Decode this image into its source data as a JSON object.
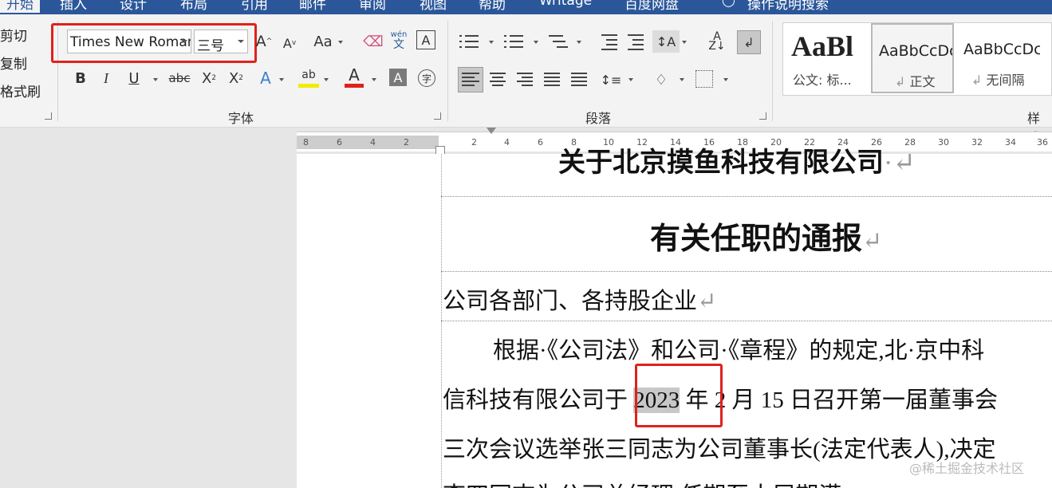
{
  "tabs": {
    "t0": "开始",
    "t1": "插入",
    "t2": "设计",
    "t3": "布局",
    "t4": "引用",
    "t5": "邮件",
    "t6": "审阅",
    "t7": "视图",
    "t8": "帮助",
    "t9": "Writage",
    "t10": "百度网盘",
    "t11": "操作说明搜索"
  },
  "clipboard": {
    "cut": "剪切",
    "copy": "复制",
    "format_painter": "格式刷"
  },
  "font": {
    "name": "Times New Roman",
    "size": "三号",
    "group_label": "字体"
  },
  "paragraph": {
    "group_label": "段落"
  },
  "styles": {
    "group_label": "样式",
    "items": [
      "公文: 标...",
      "正文",
      "无间隔"
    ],
    "previews": [
      "AaBl",
      "AaBbCcDc",
      "AaBbCcDc"
    ]
  },
  "ruler": {
    "left_numbers": [
      "8",
      "6",
      "4",
      "2"
    ],
    "right_numbers": [
      "2",
      "4",
      "6",
      "8",
      "10",
      "12",
      "14",
      "16",
      "18",
      "20",
      "22",
      "24",
      "26",
      "28",
      "30",
      "32",
      "34",
      "36"
    ]
  },
  "document": {
    "title_line1": "关于北京摸鱼科技有限公司",
    "title_line2": "有关任职的通报",
    "recipient": "公司各部门、各持股企业",
    "body_line1": "根据·《公司法》和公司·《章程》的规定,北·京中科",
    "body_line2_pre": "信科技有限公司于",
    "body_line2_year": "2023",
    "body_line2_post": "年 2 月 15 日召开第一届董事会",
    "body_line3": "三次会议选举张三同志为公司董事长(法定代表人),决定",
    "body_line4": "李四同志为公司总经理,任期至本届期满。"
  },
  "watermark": "@稀土掘金技术社区",
  "colors": {
    "accent": "#2b579a",
    "highlight_box": "#e0211b",
    "selection": "#c8c8c8"
  }
}
